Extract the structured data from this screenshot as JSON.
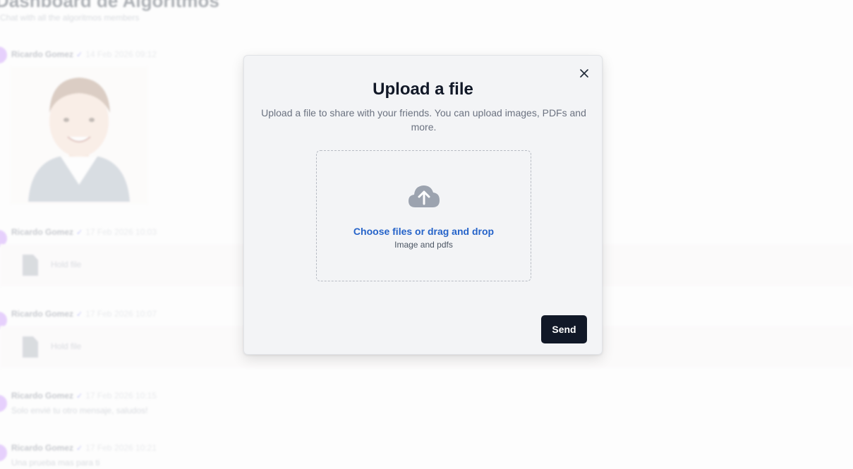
{
  "background": {
    "page_title": "Dashboard de Algoritmos",
    "page_subtitle": "Chat with all the algoritmos members",
    "messages": [
      {
        "name": "Ricardo Gomez",
        "date": "14 Feb 2026 09:12"
      },
      {
        "name": "Ricardo Gomez",
        "date": "17 Feb 2026 10:03",
        "file": "Hold file"
      },
      {
        "name": "Ricardo Gomez",
        "date": "17 Feb 2026 10:07",
        "file": "Hold file"
      },
      {
        "name": "Ricardo Gomez",
        "date": "17 Feb 2026 10:15",
        "text": "Solo envié tu otro mensaje, saludos!"
      },
      {
        "name": "Ricardo Gomez",
        "date": "17 Feb 2026 10:21",
        "text": "Una prueba mas para ti"
      }
    ]
  },
  "modal": {
    "title": "Upload a file",
    "description": "Upload a file to share with your friends. You can upload images, PDFs and more.",
    "dropzone": {
      "main_label": "Choose files or drag and drop",
      "sub_label": "Image and pdfs"
    },
    "send_label": "Send",
    "close_icon": "close-icon",
    "upload_icon": "cloud-upload-icon"
  },
  "colors": {
    "accent": "#2563c9",
    "primary_button": "#111827",
    "modal_bg": "#f3f4f6"
  }
}
